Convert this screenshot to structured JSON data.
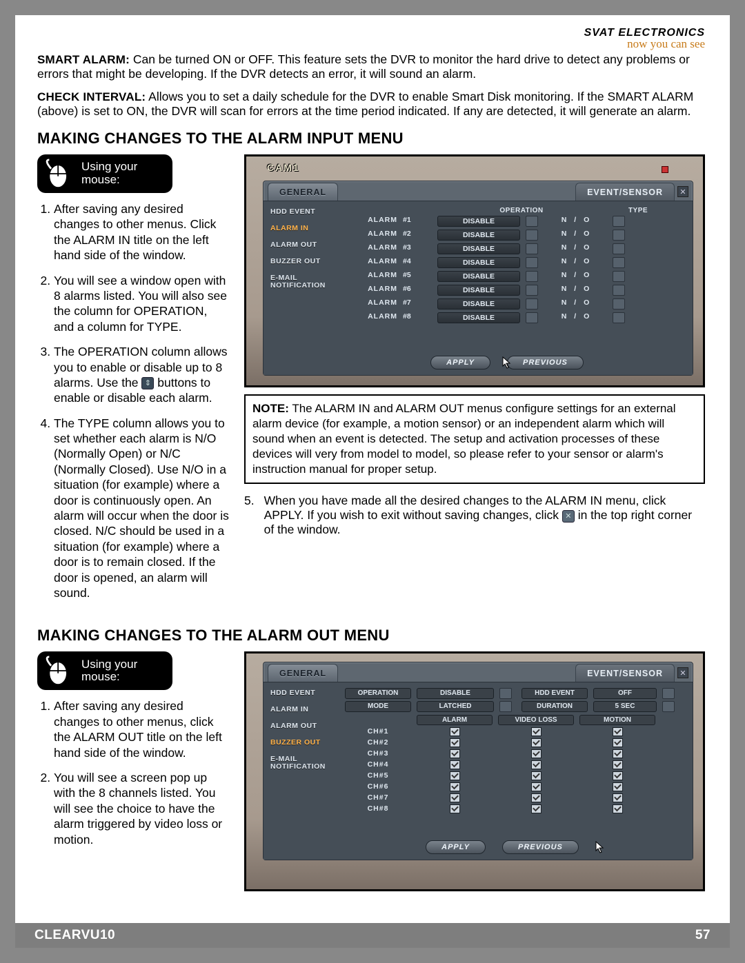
{
  "brand": {
    "name": "SVAT ELECTRONICS",
    "tagline": "now you can see"
  },
  "defs": {
    "smart_alarm": {
      "term": "SMART ALARM:",
      "text": "Can be turned ON or OFF.  This feature sets the DVR to monitor the hard drive to detect any problems or errors that might be developing.  If the DVR detects an error, it will sound an alarm."
    },
    "check_interval": {
      "term": "CHECK INTERVAL:",
      "text": "Allows you to set a daily schedule for the DVR to enable Smart Disk monitoring.  If the SMART ALARM (above) is set to ON, the DVR will scan for errors at the time period indicated.  If any are detected, it will generate an alarm."
    }
  },
  "sections": {
    "alarm_in_title": "MAKING CHANGES TO THE ALARM INPUT MENU",
    "alarm_out_title": "MAKING CHANGES TO THE ALARM OUT MENU"
  },
  "mouse_badge": {
    "line1": "Using your",
    "line2": "mouse:"
  },
  "alarm_in_steps": [
    "After saving any desired changes to other menus. Click the ALARM IN title on the left hand side of the window.",
    "You will see a window open with 8 alarms listed.  You will also see the column for OPERATION, and a column for TYPE.",
    "The OPERATION column allows you to enable or disable up to 8 alarms.  Use the  ⇕  buttons to enable or disable each alarm.",
    "The TYPE column allows you to set whether each alarm is N/O (Normally Open) or N/C (Normally Closed).  Use N/O in a situation (for example) where a door is continuously open.  An alarm will occur when the door is closed.  N/C should be used in a situation (for example) where a door is to remain closed.  If the door is opened, an alarm will sound."
  ],
  "alarm_in_step5": {
    "num": "5.",
    "text_a": "When you have made all the desired changes to the ALARM IN menu, click APPLY.  If you wish to exit without saving changes, click ",
    "text_b": " in the top right corner of the window."
  },
  "note": {
    "label": "NOTE:",
    "text": "The ALARM IN and ALARM OUT menus configure settings for an external alarm device (for example, a motion sensor) or an independent alarm which will sound when an event is detected. The setup and activation processes of these devices will very from model to model, so please refer to your sensor or alarm's instruction manual for proper setup."
  },
  "alarm_out_steps": [
    "After saving any desired changes to other menus, click the ALARM OUT title on the left hand side of the window.",
    "You will see a screen pop up with the 8 channels listed.  You will see the choice to have the alarm triggered by video loss or motion."
  ],
  "dvr": {
    "cam": "CAM1",
    "tab_general": "GENERAL",
    "tab_event": "EVENT/SENSOR",
    "side": {
      "hdd": "HDD EVENT",
      "alarm_in": "ALARM IN",
      "alarm_out": "ALARM OUT",
      "buzzer": "BUZZER OUT",
      "email": "E-MAIL NOTIFICATION"
    },
    "apply": "APPLY",
    "previous": "PREVIOUS"
  },
  "dvr1": {
    "col_operation": "OPERATION",
    "col_type": "TYPE",
    "row_label": "ALARM",
    "disable": "DISABLE",
    "nio": "N  /  O",
    "rows": [
      "#1",
      "#2",
      "#3",
      "#4",
      "#5",
      "#6",
      "#7",
      "#8"
    ]
  },
  "dvr2": {
    "op_label": "OPERATION",
    "op_value": "DISABLE",
    "hdd_label": "HDD EVENT",
    "hdd_value": "OFF",
    "mode_label": "MODE",
    "mode_value": "LATCHED",
    "dur_label": "DURATION",
    "dur_value": "5  SEC",
    "col_alarm": "ALARM",
    "col_video": "VIDEO LOSS",
    "col_motion": "MOTION",
    "rows": [
      "CH#1",
      "CH#2",
      "CH#3",
      "CH#4",
      "CH#5",
      "CH#6",
      "CH#7",
      "CH#8"
    ]
  },
  "footer": {
    "product": "CLEARVU10",
    "page": "57"
  }
}
